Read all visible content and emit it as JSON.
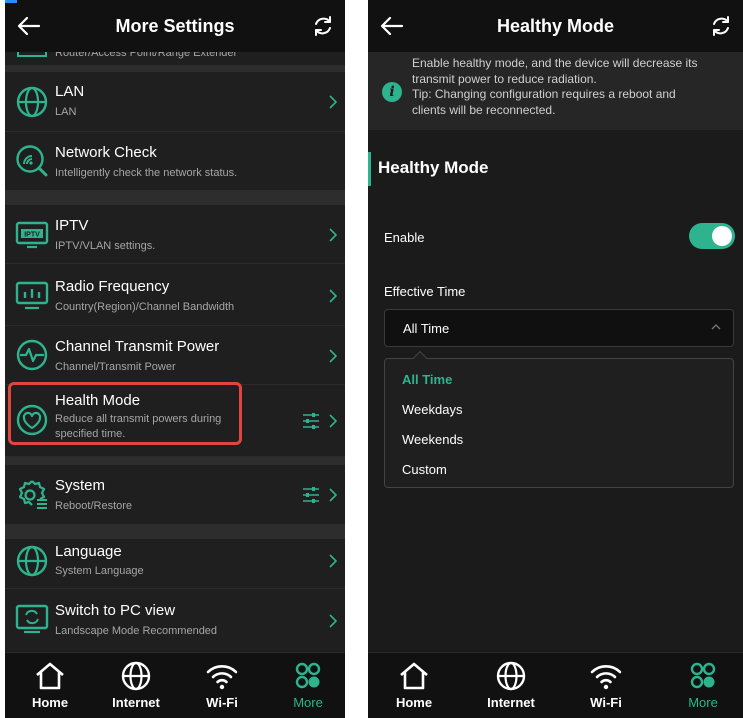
{
  "left_screen": {
    "title": "More Settings",
    "partial_item_subtitle": "Router/Access Point/Range Extender",
    "items": [
      {
        "label": "LAN",
        "subtitle": "LAN",
        "icon": "globe-icon"
      },
      {
        "label": "Network Check",
        "subtitle": "Intelligently check the network status.",
        "icon": "network-check-icon"
      },
      {
        "label": "IPTV",
        "subtitle": "IPTV/VLAN settings.",
        "icon": "iptv-icon"
      },
      {
        "label": "Radio Frequency",
        "subtitle": "Country(Region)/Channel Bandwidth",
        "icon": "radio-frequency-icon"
      },
      {
        "label": "Channel Transmit Power",
        "subtitle": "Channel/Transmit Power",
        "icon": "transmit-power-icon"
      },
      {
        "label": "Health Mode",
        "subtitle": "Reduce all transmit powers during specified time.",
        "icon": "heart-icon"
      },
      {
        "label": "System",
        "subtitle": "Reboot/Restore",
        "icon": "system-gear-icon"
      },
      {
        "label": "Language",
        "subtitle": "System Language",
        "icon": "globe-icon"
      },
      {
        "label": "Switch to PC view",
        "subtitle": "Landscape Mode Recommended",
        "icon": "pc-view-icon"
      }
    ]
  },
  "right_screen": {
    "title": "Healthy Mode",
    "notice_text": "Enable healthy mode, and the device will decrease its transmit power to reduce radiation.",
    "notice_tip": "Tip: Changing configuration requires a reboot and clients will be reconnected.",
    "section_title": "Healthy Mode",
    "enable_label": "Enable",
    "enable_on": true,
    "effective_time_label": "Effective Time",
    "effective_time_value": "All Time",
    "options": [
      "All Time",
      "Weekdays",
      "Weekends",
      "Custom"
    ],
    "selected_option": "All Time"
  },
  "bottom_nav": {
    "items": [
      {
        "label": "Home",
        "icon": "home-icon"
      },
      {
        "label": "Internet",
        "icon": "globe-icon"
      },
      {
        "label": "Wi-Fi",
        "icon": "wifi-icon"
      },
      {
        "label": "More",
        "icon": "more-icon"
      }
    ],
    "active": "More"
  },
  "colors": {
    "accent": "#2db38d",
    "highlight_border": "#e0463f",
    "background": "#1a1a1a",
    "topbar": "#111111"
  }
}
